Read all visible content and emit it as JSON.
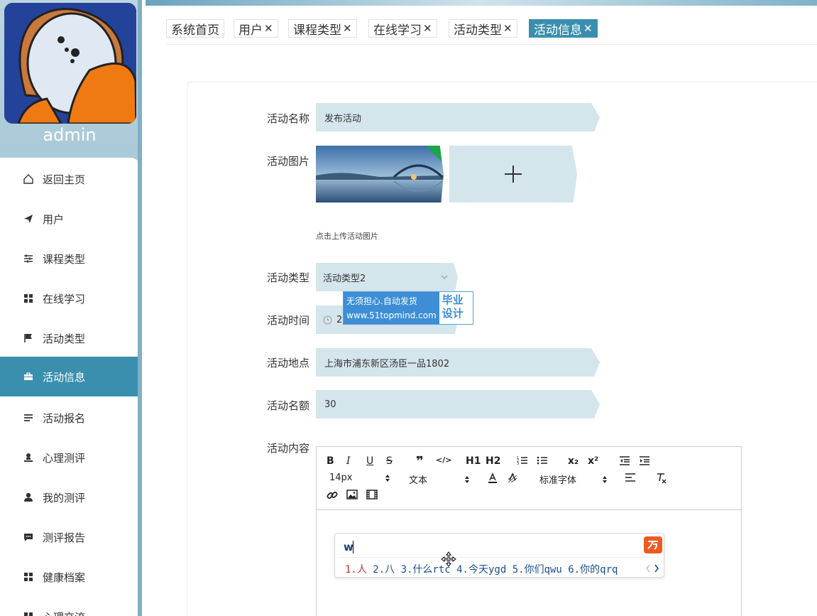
{
  "sidebar": {
    "username": "admin",
    "items": [
      {
        "label": "返回主页",
        "icon": "home-icon"
      },
      {
        "label": "用户",
        "icon": "paper-plane-icon"
      },
      {
        "label": "课程类型",
        "icon": "sliders-icon"
      },
      {
        "label": "在线学习",
        "icon": "grid-icon"
      },
      {
        "label": "活动类型",
        "icon": "flag-icon"
      },
      {
        "label": "活动信息",
        "icon": "briefcase-icon"
      },
      {
        "label": "活动报名",
        "icon": "list-icon"
      },
      {
        "label": "心理测评",
        "icon": "user-stamp-icon"
      },
      {
        "label": "我的测评",
        "icon": "user-icon"
      },
      {
        "label": "测评报告",
        "icon": "comment-icon"
      },
      {
        "label": "健康档案",
        "icon": "grid-icon"
      },
      {
        "label": "心理交流",
        "icon": "grid-icon"
      }
    ],
    "active_index": 5
  },
  "tabs": [
    {
      "label": "系统首页",
      "closable": false
    },
    {
      "label": "用户",
      "closable": true
    },
    {
      "label": "课程类型",
      "closable": true
    },
    {
      "label": "在线学习",
      "closable": true
    },
    {
      "label": "活动类型",
      "closable": true
    },
    {
      "label": "活动信息",
      "closable": true
    }
  ],
  "tab_close_glyph": "✕",
  "form": {
    "name_label": "活动名称",
    "name_value": "发布活动",
    "image_label": "活动图片",
    "image_hint": "点击上传活动图片",
    "type_label": "活动类型",
    "type_value": "活动类型2",
    "time_label": "活动时间",
    "time_value": "2",
    "location_label": "活动地点",
    "location_value": "上海市浦东新区汤臣一品1802",
    "quota_label": "活动名额",
    "quota_value": "30",
    "content_label": "活动内容"
  },
  "editor": {
    "font_size": "14px",
    "header_type": "文本",
    "font_family": "标准字体",
    "buttons_row1": [
      "B",
      "I",
      "U",
      "S",
      "❞",
      "</>",
      "H1",
      "H2",
      "ol",
      "ul",
      "x₂",
      "x²",
      "outdent",
      "indent"
    ]
  },
  "ime": {
    "input": "w",
    "candidates": "1.人 2.八 3.什么rtc 4.今天ygd 5.你们qwu 6.你的qrq"
  },
  "watermark": {
    "line1": "无须担心.自动发货",
    "line2": "www.51topmind.com",
    "right1": "毕业",
    "right2": "设计"
  },
  "colors": {
    "accent": "#3a8fae",
    "field_bg": "#d4e5ec",
    "ime_logo": "#f05a22"
  }
}
